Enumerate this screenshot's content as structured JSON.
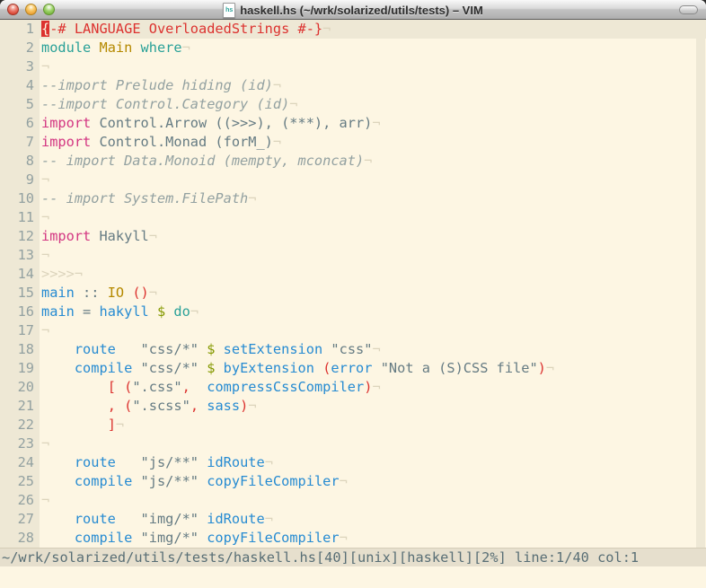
{
  "window": {
    "title": "haskell.hs (~/wrk/solarized/utils/tests) – VIM",
    "doc_icon_label": "hs"
  },
  "colors": {
    "bg": "#fdf6e3",
    "bghi": "#eee8d5",
    "base": "#657b83",
    "string": "#657b83",
    "comment": "#93a1a1",
    "linenr": "#93a1a1",
    "faint": "#dcd4bc",
    "red": "#dc322f",
    "blue": "#268bd2",
    "teal": "#2aa198",
    "yellow": "#b58900",
    "magenta": "#d33682",
    "green": "#859900",
    "statusbg": "#e6dfcd",
    "statusfg": "#586e75"
  },
  "editor": {
    "eol_marker": "¬",
    "lines": [
      {
        "n": "1",
        "cursor_line": true,
        "eol": "¬",
        "segs": [
          [
            "cursor",
            "{"
          ],
          [
            "red",
            "-# LANGUAGE OverloadedStrings #-}"
          ]
        ]
      },
      {
        "n": "2",
        "eol": "¬",
        "segs": [
          [
            "teal",
            "module"
          ],
          [
            "base",
            " "
          ],
          [
            "yellow",
            "Main"
          ],
          [
            "base",
            " "
          ],
          [
            "teal",
            "where"
          ]
        ]
      },
      {
        "n": "3",
        "eol": "¬",
        "segs": []
      },
      {
        "n": "4",
        "eol": "¬",
        "segs": [
          [
            "comment",
            "--import Prelude hiding (id)"
          ]
        ]
      },
      {
        "n": "5",
        "eol": "¬",
        "segs": [
          [
            "comment",
            "--import Control.Category (id)"
          ]
        ]
      },
      {
        "n": "6",
        "eol": "¬",
        "segs": [
          [
            "magenta",
            "import"
          ],
          [
            "base",
            " Control.Arrow ((>>>), (***), arr)"
          ]
        ]
      },
      {
        "n": "7",
        "eol": "¬",
        "segs": [
          [
            "magenta",
            "import"
          ],
          [
            "base",
            " Control.Monad (forM_)"
          ]
        ]
      },
      {
        "n": "8",
        "eol": "¬",
        "segs": [
          [
            "comment",
            "-- import Data.Monoid (mempty, mconcat)"
          ]
        ]
      },
      {
        "n": "9",
        "eol": "¬",
        "segs": []
      },
      {
        "n": "10",
        "eol": "¬",
        "segs": [
          [
            "comment",
            "-- import System.FilePath"
          ]
        ]
      },
      {
        "n": "11",
        "eol": "¬",
        "segs": []
      },
      {
        "n": "12",
        "eol": "¬",
        "segs": [
          [
            "magenta",
            "import"
          ],
          [
            "base",
            " Hakyll"
          ]
        ]
      },
      {
        "n": "13",
        "eol": "¬",
        "segs": []
      },
      {
        "n": "14",
        "eol": "¬",
        "segs": [
          [
            "faint",
            ">>>>"
          ]
        ]
      },
      {
        "n": "15",
        "eol": "¬",
        "segs": [
          [
            "blue",
            "main"
          ],
          [
            "base",
            " :: "
          ],
          [
            "yellow",
            "IO"
          ],
          [
            "base",
            " "
          ],
          [
            "red",
            "()"
          ]
        ]
      },
      {
        "n": "16",
        "eol": "¬",
        "segs": [
          [
            "blue",
            "main"
          ],
          [
            "base",
            " = "
          ],
          [
            "blue",
            "hakyll"
          ],
          [
            "base",
            " "
          ],
          [
            "green",
            "$"
          ],
          [
            "base",
            " "
          ],
          [
            "teal",
            "do"
          ]
        ]
      },
      {
        "n": "17",
        "eol": "¬",
        "segs": []
      },
      {
        "n": "18",
        "eol": "¬",
        "segs": [
          [
            "base",
            "    "
          ],
          [
            "blue",
            "route"
          ],
          [
            "base",
            "   "
          ],
          [
            "string",
            "\"css/*\""
          ],
          [
            "base",
            " "
          ],
          [
            "green",
            "$"
          ],
          [
            "base",
            " "
          ],
          [
            "blue",
            "setExtension"
          ],
          [
            "base",
            " "
          ],
          [
            "string",
            "\"css\""
          ]
        ]
      },
      {
        "n": "19",
        "eol": "¬",
        "segs": [
          [
            "base",
            "    "
          ],
          [
            "blue",
            "compile"
          ],
          [
            "base",
            " "
          ],
          [
            "string",
            "\"css/*\""
          ],
          [
            "base",
            " "
          ],
          [
            "green",
            "$"
          ],
          [
            "base",
            " "
          ],
          [
            "blue",
            "byExtension"
          ],
          [
            "base",
            " "
          ],
          [
            "red",
            "("
          ],
          [
            "blue",
            "error"
          ],
          [
            "base",
            " "
          ],
          [
            "string",
            "\"Not a (S)CSS file\""
          ],
          [
            "red",
            ")"
          ]
        ]
      },
      {
        "n": "20",
        "eol": "¬",
        "segs": [
          [
            "base",
            "        "
          ],
          [
            "red",
            "["
          ],
          [
            "base",
            " "
          ],
          [
            "red",
            "("
          ],
          [
            "string",
            "\".css\""
          ],
          [
            "red",
            ","
          ],
          [
            "base",
            "  "
          ],
          [
            "blue",
            "compressCssCompiler"
          ],
          [
            "red",
            ")"
          ]
        ]
      },
      {
        "n": "21",
        "eol": "¬",
        "segs": [
          [
            "base",
            "        "
          ],
          [
            "red",
            ","
          ],
          [
            "base",
            " "
          ],
          [
            "red",
            "("
          ],
          [
            "string",
            "\".scss\""
          ],
          [
            "red",
            ","
          ],
          [
            "base",
            " "
          ],
          [
            "blue",
            "sass"
          ],
          [
            "red",
            ")"
          ]
        ]
      },
      {
        "n": "22",
        "eol": "¬",
        "segs": [
          [
            "base",
            "        "
          ],
          [
            "red",
            "]"
          ]
        ]
      },
      {
        "n": "23",
        "eol": "¬",
        "segs": []
      },
      {
        "n": "24",
        "eol": "¬",
        "segs": [
          [
            "base",
            "    "
          ],
          [
            "blue",
            "route"
          ],
          [
            "base",
            "   "
          ],
          [
            "string",
            "\"js/**\""
          ],
          [
            "base",
            " "
          ],
          [
            "blue",
            "idRoute"
          ]
        ]
      },
      {
        "n": "25",
        "eol": "¬",
        "segs": [
          [
            "base",
            "    "
          ],
          [
            "blue",
            "compile"
          ],
          [
            "base",
            " "
          ],
          [
            "string",
            "\"js/**\""
          ],
          [
            "base",
            " "
          ],
          [
            "blue",
            "copyFileCompiler"
          ]
        ]
      },
      {
        "n": "26",
        "eol": "¬",
        "segs": []
      },
      {
        "n": "27",
        "eol": "¬",
        "segs": [
          [
            "base",
            "    "
          ],
          [
            "blue",
            "route"
          ],
          [
            "base",
            "   "
          ],
          [
            "string",
            "\"img/*\""
          ],
          [
            "base",
            " "
          ],
          [
            "blue",
            "idRoute"
          ]
        ]
      },
      {
        "n": "28",
        "eol": "¬",
        "segs": [
          [
            "base",
            "    "
          ],
          [
            "blue",
            "compile"
          ],
          [
            "base",
            " "
          ],
          [
            "string",
            "\"img/*\""
          ],
          [
            "base",
            " "
          ],
          [
            "blue",
            "copyFileCompiler"
          ]
        ]
      }
    ]
  },
  "statusbar": {
    "text": "~/wrk/solarized/utils/tests/haskell.hs[40][unix][haskell][2%] line:1/40 col:1"
  },
  "command_line": {
    "text": ""
  }
}
